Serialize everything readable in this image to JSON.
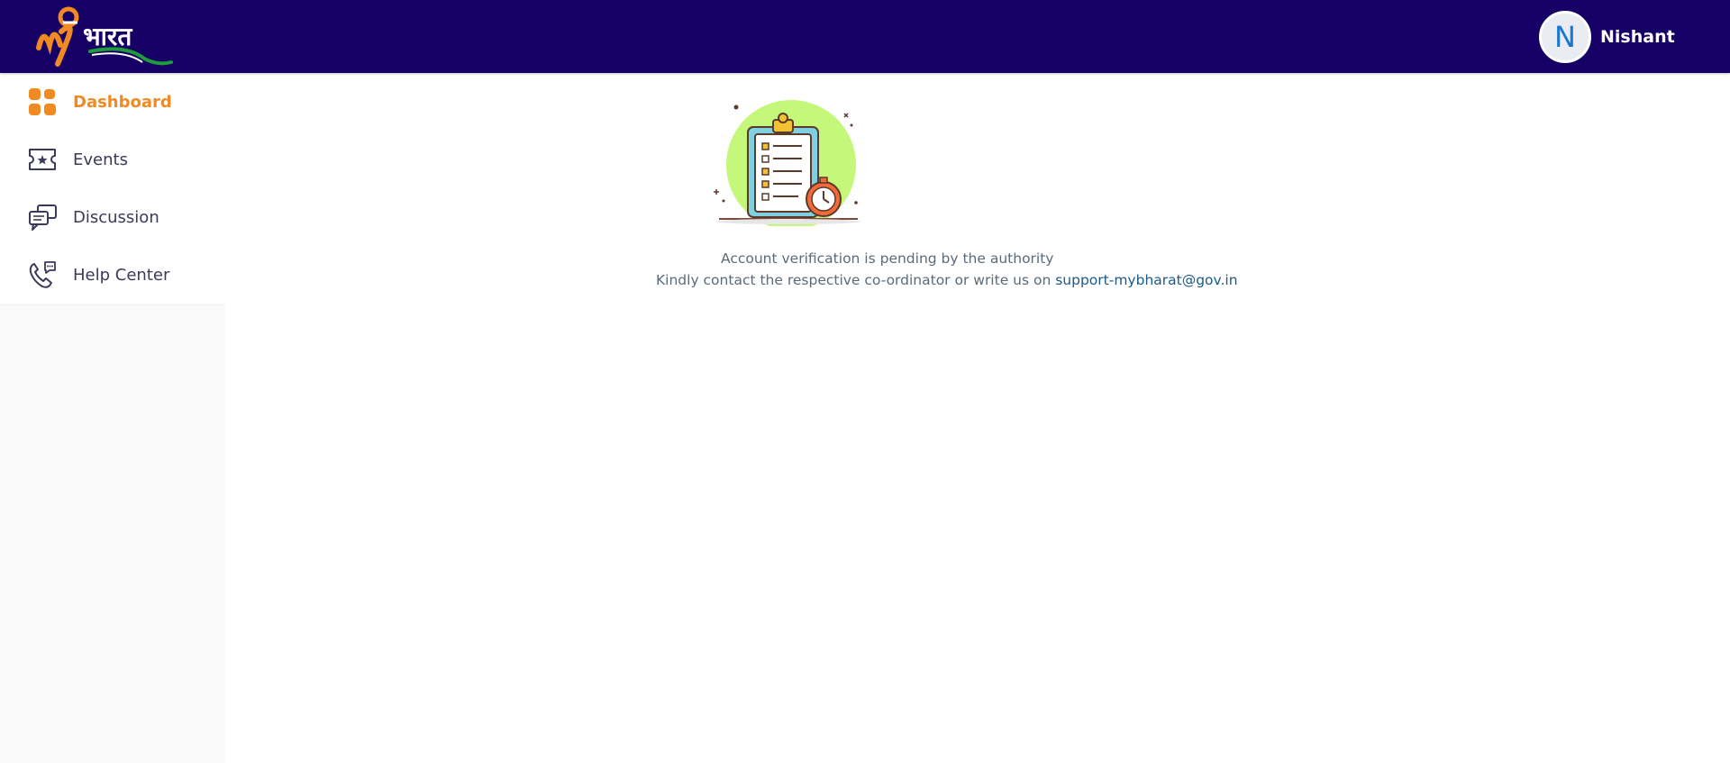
{
  "header": {
    "logo_text": "my भारत",
    "user": {
      "initial": "N",
      "name": "Nishant"
    }
  },
  "sidebar": {
    "items": [
      {
        "label": "Dashboard",
        "icon": "dashboard-grid-icon",
        "active": true
      },
      {
        "label": "Events",
        "icon": "ticket-icon",
        "active": false
      },
      {
        "label": "Discussion",
        "icon": "chat-bubbles-icon",
        "active": false
      },
      {
        "label": "Help Center",
        "icon": "phone-chat-icon",
        "active": false
      }
    ]
  },
  "main": {
    "illustration": "clipboard-checklist-stopwatch-icon",
    "message_line1": "Account verification is pending by the authority",
    "message_line2_prefix": "Kindly contact the respective co-ordinator or write us on",
    "support_email": "support-mybharat@gov.in"
  },
  "colors": {
    "header_bg": "#170065",
    "accent": "#f28a23",
    "sidebar_text": "#3a3a5a",
    "link": "#1a5a8a"
  }
}
